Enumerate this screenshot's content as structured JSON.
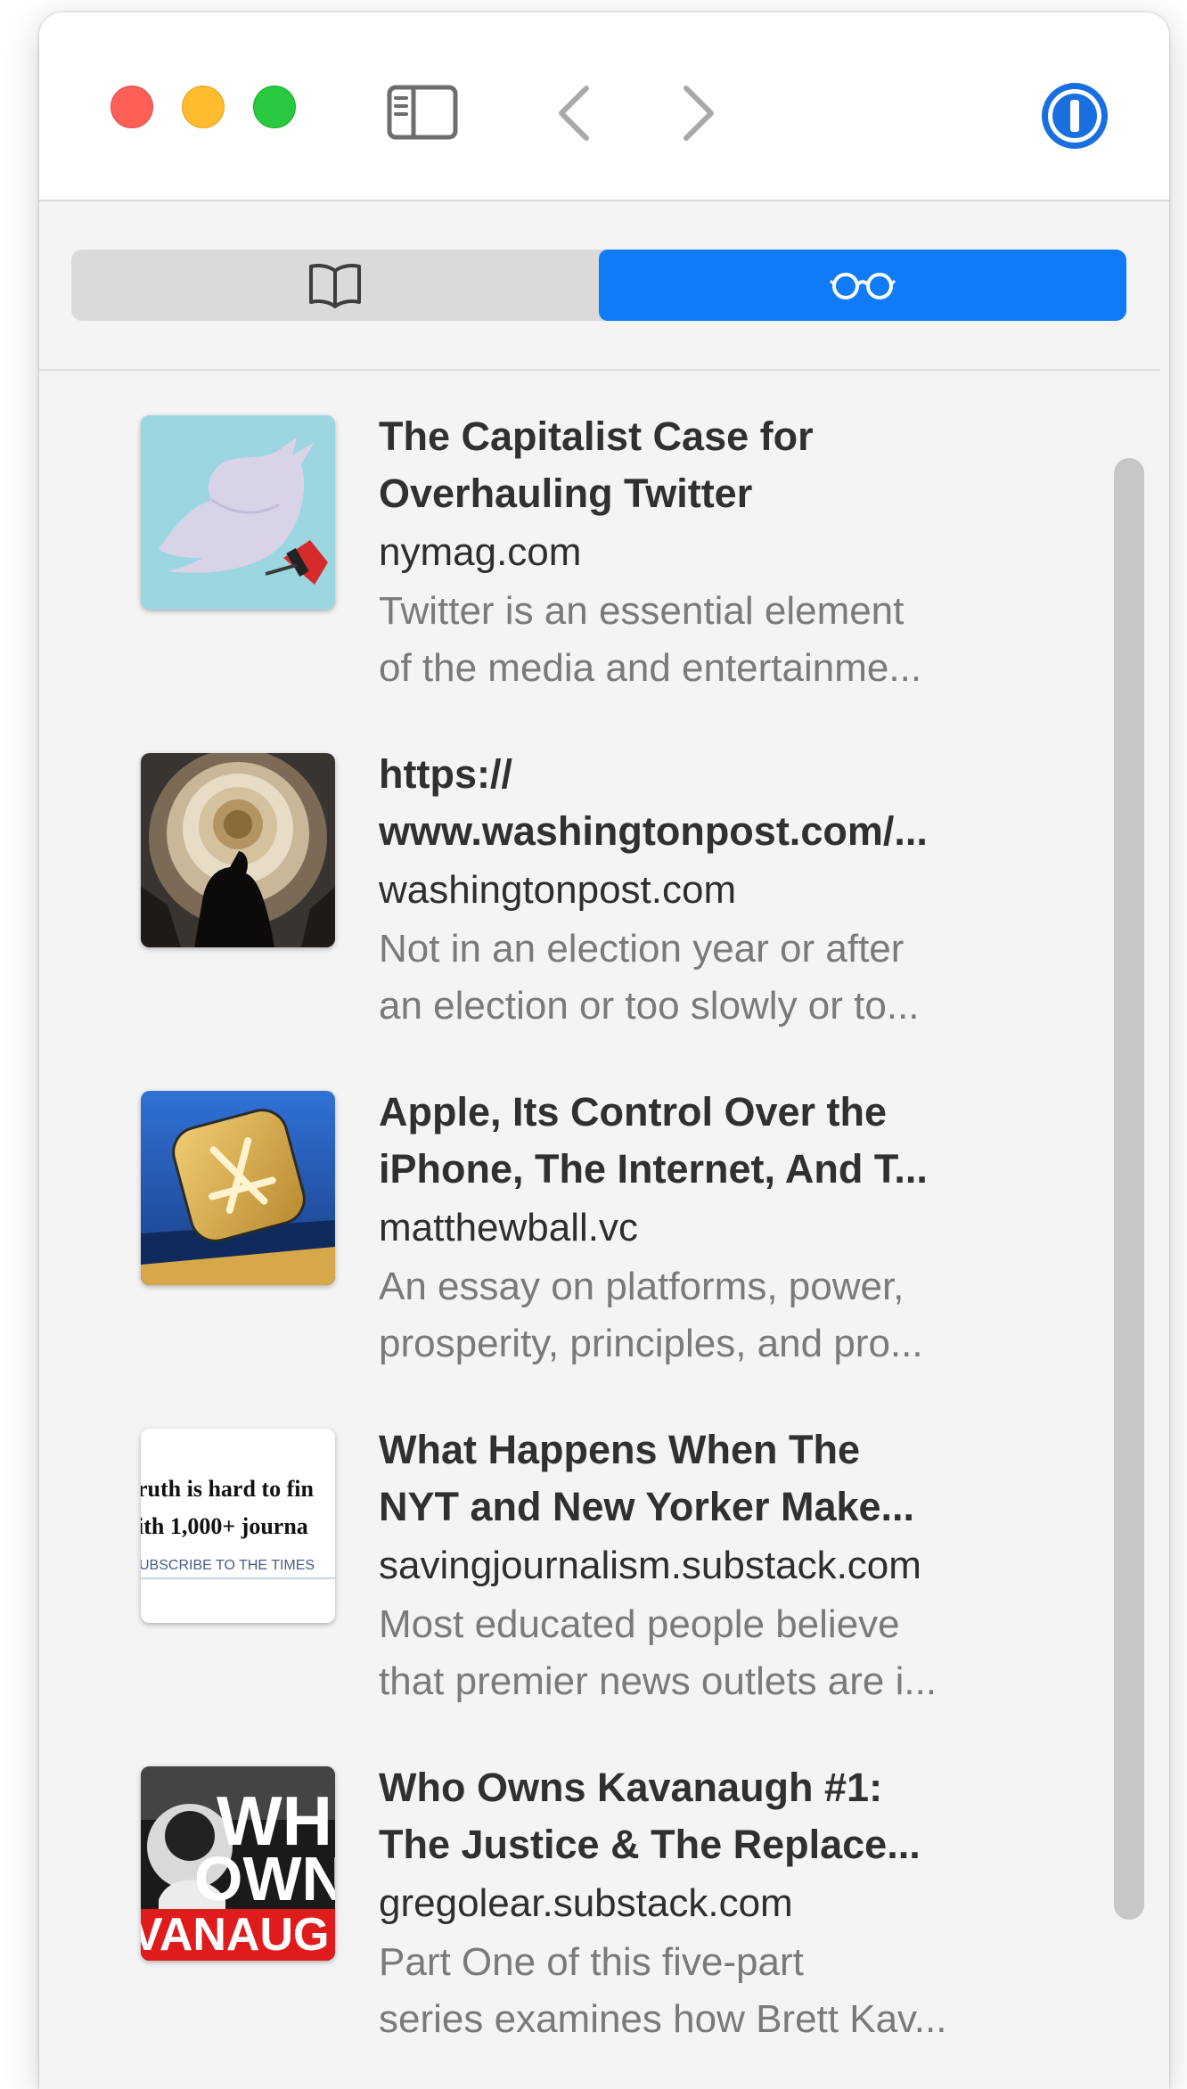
{
  "toolbar": {
    "icons": [
      "close-button",
      "minimize-button",
      "zoom-button",
      "sidebar-icon",
      "chevron-left-icon",
      "chevron-right-icon",
      "onepassword-icon"
    ],
    "accent_color": "#0f7bf6"
  },
  "segmented": {
    "tabs": [
      {
        "icon": "book-icon",
        "active": false
      },
      {
        "icon": "reading-glasses-icon",
        "active": true
      }
    ]
  },
  "reading_list": [
    {
      "title_line1": "The Capitalist Case for",
      "title_line2": "Overhauling Twitter",
      "domain": "nymag.com",
      "excerpt_line1": "Twitter is an essential element",
      "excerpt_line2": "of the media and entertainme...",
      "thumb": "twitter-bird-thumbnail"
    },
    {
      "title_line1": "https://",
      "title_line2": "www.washingtonpost.com/...",
      "domain": "washingtonpost.com",
      "excerpt_line1": "Not in an election year or after",
      "excerpt_line2": "an election or too slowly or to...",
      "thumb": "capitol-dome-thumbnail"
    },
    {
      "title_line1": "Apple, Its Control Over the",
      "title_line2": "iPhone, The Internet, And T...",
      "domain": "matthewball.vc",
      "excerpt_line1": "An essay on platforms, power,",
      "excerpt_line2": "prosperity, principles, and pro...",
      "thumb": "app-store-thumbnail"
    },
    {
      "title_line1": "What Happens When The",
      "title_line2": "NYT and New Yorker Make...",
      "domain": "savingjournalism.substack.com",
      "excerpt_line1": "Most educated people believe",
      "excerpt_line2": "that premier news outlets are i...",
      "thumb": "newspaper-ad-thumbnail",
      "thumb_text": {
        "line1": "ruth is hard to fin",
        "line2": "ith 1,000+ journa",
        "line3": "UBSCRIBE TO THE TIMES"
      }
    },
    {
      "title_line1": "Who Owns Kavanaugh #1:",
      "title_line2": "The Justice & The Replace...",
      "domain": "gregolear.substack.com",
      "excerpt_line1": "Part One of this five-part",
      "excerpt_line2": "series examines how Brett Kav...",
      "thumb": "who-owns-kavanaugh-thumbnail",
      "thumb_text": {
        "line1": "WHO",
        "line2": "OWN",
        "line3": "VANAUG"
      }
    }
  ]
}
